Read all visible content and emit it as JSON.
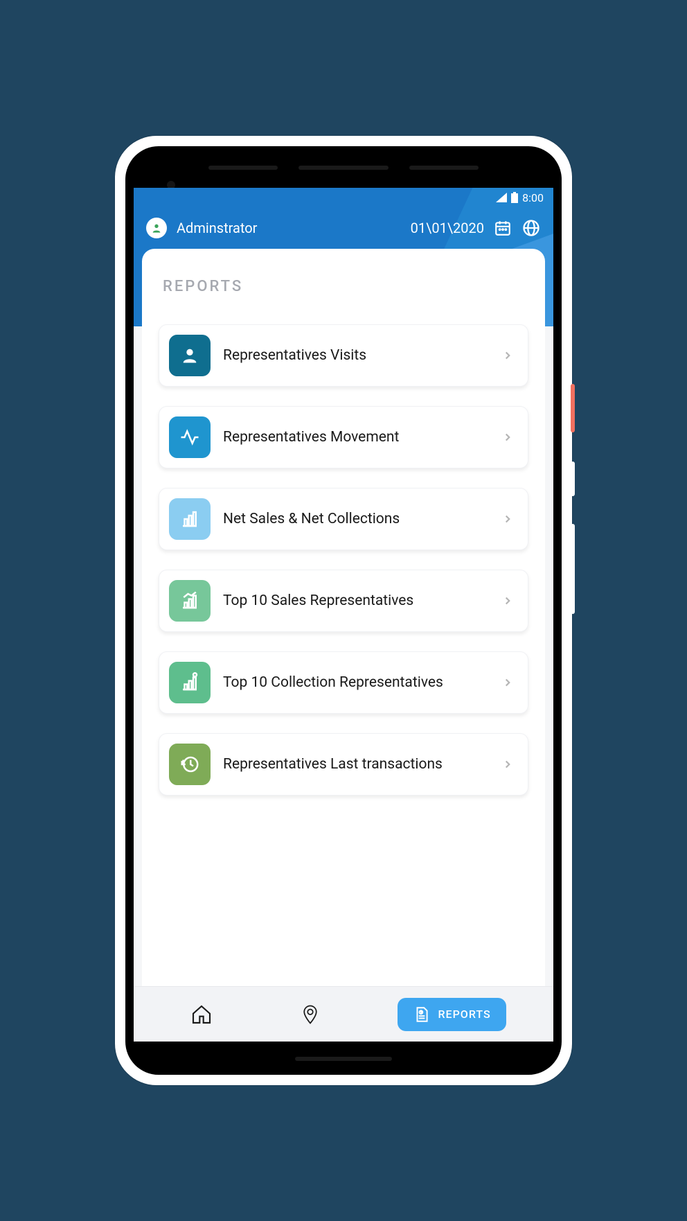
{
  "status": {
    "time": "8:00"
  },
  "header": {
    "user": "Adminstrator",
    "date": "01\\01\\2020"
  },
  "page": {
    "title": "REPORTS"
  },
  "reports": [
    {
      "label": "Representatives Visits",
      "icon": "person",
      "color": "#0f6e8f"
    },
    {
      "label": "Representatives Movement",
      "icon": "activity",
      "color": "#1f95cf"
    },
    {
      "label": "Net Sales & Net Collections",
      "icon": "bars",
      "color": "#8bcdf1"
    },
    {
      "label": "Top 10 Sales Representatives",
      "icon": "chart",
      "color": "#77c79a"
    },
    {
      "label": "Top 10 Collection Representatives",
      "icon": "chart2",
      "color": "#5ebe8d"
    },
    {
      "label": "Representatives Last transactions",
      "icon": "history",
      "color": "#7fab57"
    }
  ],
  "nav": {
    "home": "Home",
    "location": "Location",
    "reports": "REPORTS"
  }
}
